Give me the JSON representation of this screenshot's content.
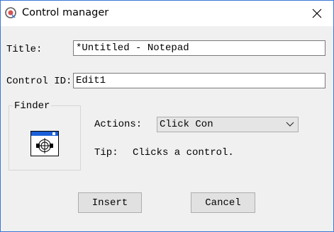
{
  "window": {
    "title": "Control manager",
    "close_icon": "close-icon",
    "app_icon": "crosshair-app-icon"
  },
  "fields": {
    "title_label": "Title:",
    "title_value": "*Untitled - Notepad",
    "control_id_label": "Control ID:",
    "control_id_value": "Edit1"
  },
  "finder": {
    "group_label": "Finder",
    "tool_icon": "finder-crosshair-icon"
  },
  "actions": {
    "label": "Actions:",
    "selected": "Click Con"
  },
  "tip": {
    "label": "Tip:",
    "text": "Clicks a control."
  },
  "buttons": {
    "insert": "Insert",
    "cancel": "Cancel"
  },
  "colors": {
    "window_border": "#3a78d6",
    "finder_title_bar": "#1a5fd8",
    "background": "#f0f0f0"
  }
}
